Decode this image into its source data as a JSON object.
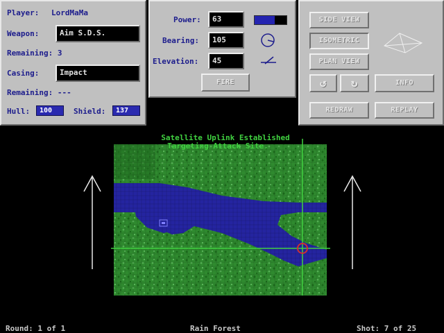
{
  "player_panel": {
    "player_label": "Player:",
    "player_name": "LordMaMa",
    "weapon_label": "Weapon:",
    "weapon_value": "Aim S.D.S.",
    "weapon_remaining": "Remaining: 3",
    "casing_label": "Casing:",
    "casing_value": "Impact",
    "casing_remaining": "Remaining: ---",
    "hull_label": "Hull:",
    "hull_value": "100",
    "shield_label": "Shield:",
    "shield_value": "137"
  },
  "aim_panel": {
    "power_label": "Power:",
    "power_value": "63",
    "power_fraction": 0.63,
    "bearing_label": "Bearing:",
    "bearing_value": "105",
    "elevation_label": "Elevation:",
    "elevation_value": "45",
    "fire_label": "FIRE"
  },
  "view_panel": {
    "side_view_label": "SIDE VIEW",
    "isometric_label": "ISOMETRIC",
    "plan_view_label": "PLAN VIEW",
    "rotate_left_glyph": "↺",
    "rotate_right_glyph": "↻",
    "info_label": "INFO",
    "redraw_label": "REDRAW",
    "replay_label": "REPLAY"
  },
  "messages": {
    "line1": "Satellite Uplink Established",
    "line2": "Targeting Attack Site."
  },
  "status_bar": {
    "round": "Round: 1 of 1",
    "terrain": "Rain Forest",
    "shot": "Shot: 7 of 25"
  },
  "colors": {
    "panel": "#c0c0c0",
    "label": "#1c1c8c",
    "forest": "#2f8a2f",
    "forest_dark": "#1f6a1f",
    "water": "#2424a0",
    "crosshair": "#40d040",
    "target": "#d03030"
  }
}
